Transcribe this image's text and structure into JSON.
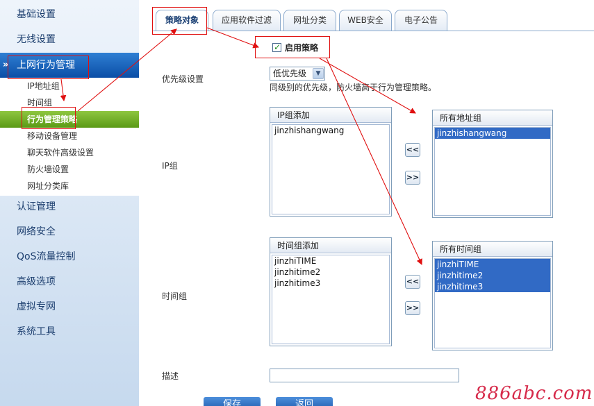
{
  "sidebar": {
    "items": [
      {
        "label": "基础设置"
      },
      {
        "label": "无线设置"
      },
      {
        "label": "上网行为管理"
      },
      {
        "label": "认证管理"
      },
      {
        "label": "网络安全"
      },
      {
        "label": "QoS流量控制"
      },
      {
        "label": "高级选项"
      },
      {
        "label": "虚拟专网"
      },
      {
        "label": "系统工具"
      }
    ],
    "active_chevron": "»",
    "submenu": [
      {
        "label": "IP地址组"
      },
      {
        "label": "时间组"
      },
      {
        "label": "行为管理策略"
      },
      {
        "label": "移动设备管理"
      },
      {
        "label": "聊天软件高级设置"
      },
      {
        "label": "防火墙设置"
      },
      {
        "label": "网址分类库"
      }
    ]
  },
  "tabs": [
    {
      "label": "策略对象"
    },
    {
      "label": "应用软件过滤"
    },
    {
      "label": "网址分类"
    },
    {
      "label": "WEB安全"
    },
    {
      "label": "电子公告"
    }
  ],
  "form": {
    "enable_label": "启用策略",
    "enable_checked": true,
    "priority_label": "优先级设置",
    "priority_value": "低优先级",
    "priority_hint": "同级别的优先级，防火墙高于行为管理策略。",
    "ip_group_label": "IP组",
    "ip_added_header": "IP组添加",
    "ip_added_items": [
      "jinzhishangwang"
    ],
    "ip_all_header": "所有地址组",
    "ip_all_items": [
      "jinzhishangwang"
    ],
    "time_group_label": "时间组",
    "time_added_header": "时间组添加",
    "time_added_items": [
      "jinzhiTIME",
      "jinzhitime2",
      "jinzhitime3"
    ],
    "time_all_header": "所有时间组",
    "time_all_items": [
      "jinzhiTIME",
      "jinzhitime2",
      "jinzhitime3"
    ],
    "move_left": "<<",
    "move_right": ">>",
    "desc_label": "描述",
    "desc_value": "",
    "save_label": "保存",
    "back_label": "返回"
  },
  "watermark": "886abc.com",
  "colors": {
    "annotation": "#e01010",
    "accent_blue": "#0b4ea6",
    "active_green": "#6aa822",
    "selection": "#316ac5"
  }
}
